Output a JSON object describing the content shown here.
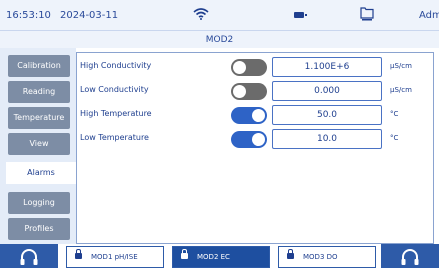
{
  "status": {
    "time": "16:53:10",
    "date": "2024-03-11",
    "user": "Admi"
  },
  "title": "MOD2",
  "sidebar": {
    "tabs": [
      {
        "label": "Calibration"
      },
      {
        "label": "Reading"
      },
      {
        "label": "Temperature"
      },
      {
        "label": "View"
      },
      {
        "label": "Alarms"
      },
      {
        "label": "Logging"
      },
      {
        "label": "Profiles"
      }
    ],
    "active": "Alarms"
  },
  "alarms": [
    {
      "label": "High Conductivity",
      "enabled": false,
      "value": "1.100E+6",
      "unit": "µS/cm"
    },
    {
      "label": "Low Conductivity",
      "enabled": false,
      "value": "0.000",
      "unit": "µS/cm"
    },
    {
      "label": "High Temperature",
      "enabled": true,
      "value": "50.0",
      "unit": "°C"
    },
    {
      "label": "Low Temperature",
      "enabled": true,
      "value": "10.0",
      "unit": "°C"
    }
  ],
  "modules": [
    {
      "label": "MOD1 pH/ISE",
      "active": false
    },
    {
      "label": "MOD2 EC",
      "active": true
    },
    {
      "label": "MOD3 DO",
      "active": false
    }
  ],
  "colors": {
    "accent": "#2e5ba8",
    "toggle_on": "#2e63c6",
    "toggle_off": "#6b6b6b",
    "sidebar_tab": "#7d8da5"
  }
}
